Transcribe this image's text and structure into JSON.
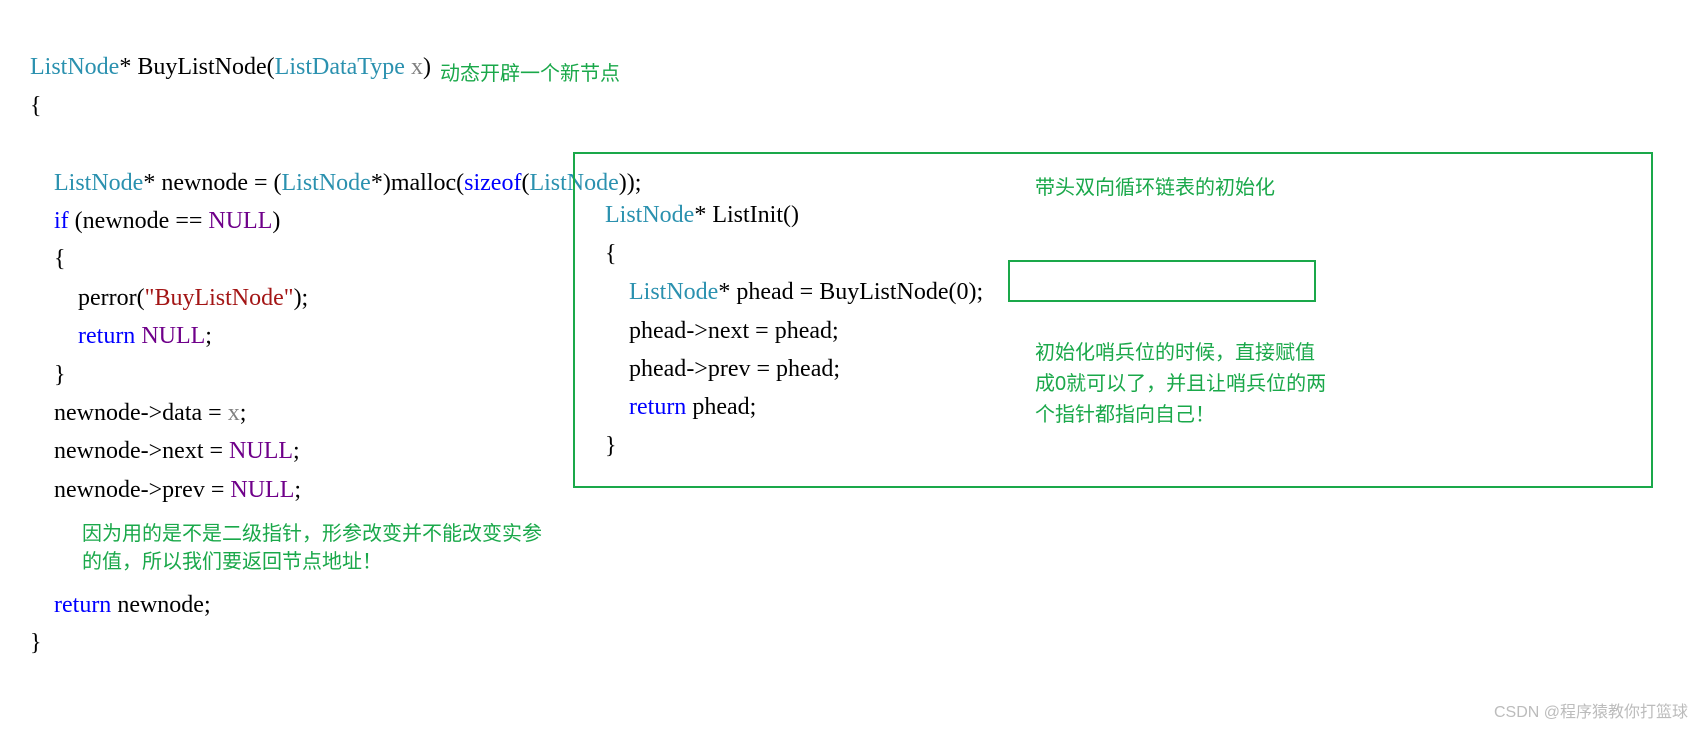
{
  "left": {
    "sig_type1": "ListNode",
    "sig_fn": "BuyListNode",
    "sig_ptype": "ListDataType",
    "sig_pname": "x",
    "annot_top": "动态开辟一个新节点",
    "l1_type1": "ListNode",
    "l1_var": "newnode",
    "l1_type2": "ListNode",
    "l1_fn": "malloc",
    "l1_kw": "sizeof",
    "l1_type3": "ListNode",
    "l2_kw": "if",
    "l2_var": "newnode",
    "l2_null": "NULL",
    "l4_fn": "perror",
    "l4_str": "\"BuyListNode\"",
    "l5_kw": "return",
    "l5_null": "NULL",
    "l7_a": "newnode",
    "l7_b": "data",
    "l7_c": "x",
    "l8_a": "newnode",
    "l8_b": "next",
    "l8_null": "NULL",
    "l9_a": "newnode",
    "l9_b": "prev",
    "l9_null": "NULL",
    "annot_mid1": "因为用的是不是二级指针，形参改变并不能改变实参",
    "annot_mid2": "的值，所以我们要返回节点地址！",
    "l10_kw": "return",
    "l10_var": "newnode"
  },
  "right": {
    "sig_type": "ListNode",
    "sig_fn": "ListInit",
    "annot_top": "带头双向循环链表的初始化",
    "l1_type": "ListNode",
    "l1_var": "phead",
    "l1_fn": "BuyListNode",
    "l1_arg": "0",
    "l2_a": "phead",
    "l2_b": "next",
    "l2_c": "phead",
    "l3_a": "phead",
    "l3_b": "prev",
    "l3_c": "phead",
    "l4_kw": "return",
    "l4_var": "phead",
    "annot_r1": "初始化哨兵位的时候，直接赋值",
    "annot_r2": "成0就可以了，并且让哨兵位的两",
    "annot_r3": "个指针都指向自己！"
  },
  "watermark": "CSDN @程序猿教你打篮球"
}
